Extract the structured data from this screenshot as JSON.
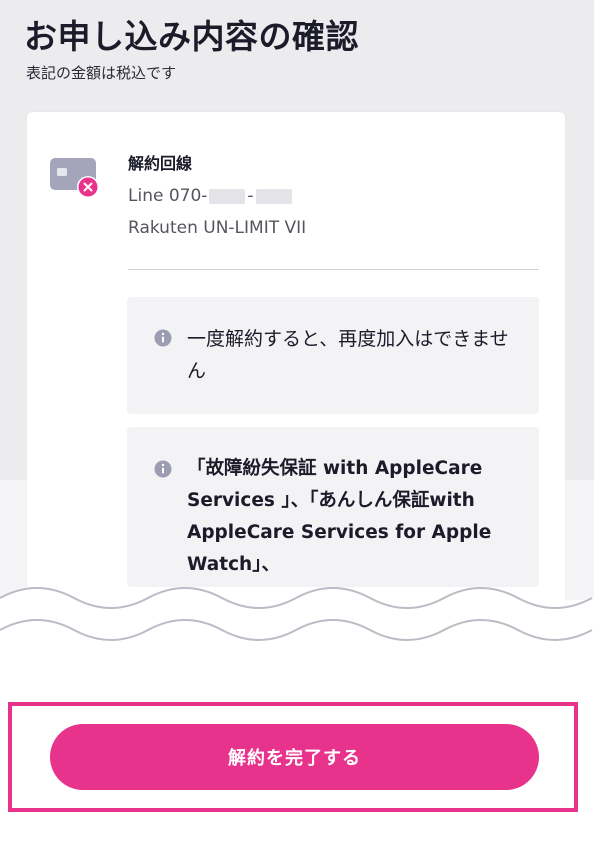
{
  "header": {
    "title": "お申し込み内容の確認",
    "subtitle": "表記の金額は税込です"
  },
  "line": {
    "heading": "解約回線",
    "number_prefix": "Line 070-",
    "number_sep": "-",
    "plan": "Rakuten UN-LIMIT VII",
    "icon": "sim-card-remove-icon"
  },
  "notices": [
    {
      "icon": "info-icon",
      "text": "一度解約すると、再度加入はできません"
    },
    {
      "icon": "info-icon",
      "text": "「故障紛失保証 with AppleCare Services 」、「あんしん保証with AppleCare Services for Apple Watch」、"
    }
  ],
  "actions": {
    "complete_label": "解約を完了する"
  },
  "colors": {
    "accent": "#e8338c",
    "background": "#ececee",
    "card": "#ffffff",
    "notice_bg": "#f3f3f5"
  }
}
